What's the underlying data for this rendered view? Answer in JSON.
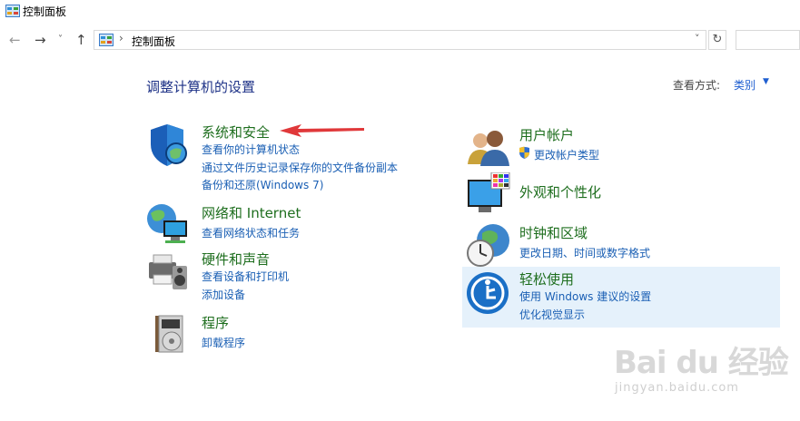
{
  "window": {
    "title": "控制面板"
  },
  "address": {
    "path": "控制面板",
    "separator": "›"
  },
  "header": {
    "heading": "调整计算机的设置",
    "view_by_label": "查看方式:",
    "view_by_value": "类别"
  },
  "categories": {
    "system": {
      "title": "系统和安全",
      "links": [
        "查看你的计算机状态",
        "通过文件历史记录保存你的文件备份副本",
        "备份和还原(Windows 7)"
      ]
    },
    "network": {
      "title": "网络和 Internet",
      "links": [
        "查看网络状态和任务"
      ]
    },
    "hardware": {
      "title": "硬件和声音",
      "links": [
        "查看设备和打印机",
        "添加设备"
      ]
    },
    "programs": {
      "title": "程序",
      "links": [
        "卸载程序"
      ]
    },
    "user": {
      "title": "用户帐户",
      "links": [
        "更改帐户类型"
      ]
    },
    "appearance": {
      "title": "外观和个性化",
      "links": []
    },
    "clock": {
      "title": "时钟和区域",
      "links": [
        "更改日期、时间或数字格式"
      ]
    },
    "ease": {
      "title": "轻松使用",
      "links": [
        "使用 Windows 建议的设置",
        "优化视觉显示"
      ]
    }
  },
  "watermark": {
    "brand": "Bai du 经验",
    "url": "jingyan.baidu.com"
  },
  "colors": {
    "accent": "#1f5fd0",
    "category_title": "#1e6e1e",
    "link": "#1a5fb4",
    "hover": "#e5f1fb",
    "arrow": "#e0383a"
  }
}
